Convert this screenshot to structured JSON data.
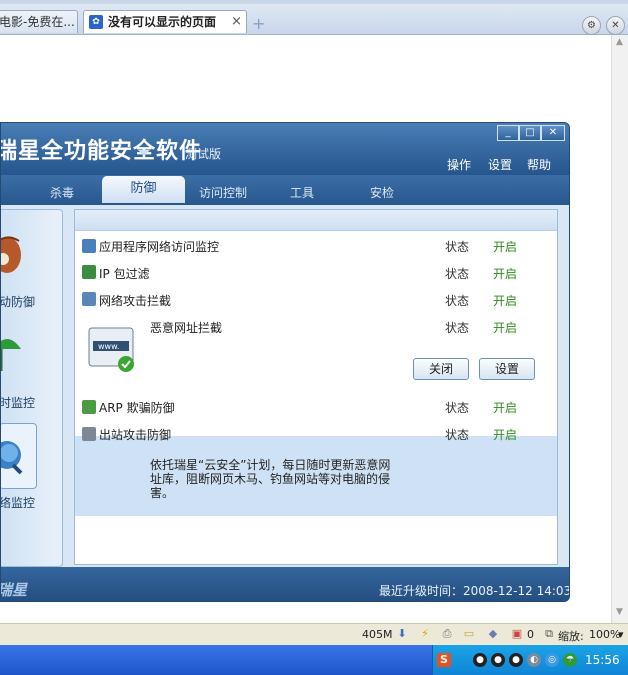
{
  "browser": {
    "tabs": [
      {
        "label": "电影-免费在..."
      },
      {
        "label": "没有可以显示的页面"
      }
    ],
    "tab_close_glyph": "×",
    "new_tab_glyph": "+",
    "tools_icon": "wrench-icon",
    "close_all_icon": "close-icon"
  },
  "app": {
    "title": "瑞星全功能安全软件",
    "edition": "测试版",
    "header_menu": [
      "操作",
      "设置",
      "帮助"
    ],
    "window_controls": [
      "minimize",
      "maximize",
      "close"
    ],
    "nav_tabs": [
      "杀毒",
      "防御",
      "访问控制",
      "工具",
      "安检"
    ],
    "active_tab": "防御",
    "left_panel": [
      {
        "label": "主动防御",
        "icon": "shield-glove-icon"
      },
      {
        "label": "实时监控",
        "icon": "umbrella-icon"
      },
      {
        "label": "网络监控",
        "icon": "globe-icon"
      }
    ],
    "rows": [
      {
        "label": "应用程序网络访问监控",
        "state": "状态",
        "value": "开启",
        "icon": "app-network-icon"
      },
      {
        "label": "IP 包过滤",
        "state": "状态",
        "value": "开启",
        "icon": "ip-filter-icon"
      },
      {
        "label": "网络攻击拦截",
        "state": "状态",
        "value": "开启",
        "icon": "attack-block-icon"
      }
    ],
    "expanded_row": {
      "label": "恶意网址拦截",
      "state": "状态",
      "value": "开启",
      "description": "依托瑞星“云安全”计划，每日随时更新恶意网址库，阻断网页木马、钓鱼网站等对电脑的侵害。",
      "icon_text": "www.",
      "close_button": "关闭",
      "settings_button": "设置"
    },
    "rows_after": [
      {
        "label": "ARP 欺骗防御",
        "state": "状态",
        "value": "开启",
        "icon": "arp-icon"
      },
      {
        "label": "出站攻击防御",
        "state": "状态",
        "value": "开启",
        "icon": "outbound-icon"
      }
    ],
    "footer_logo": "瑞星",
    "last_update_label": "最近升级时间：",
    "last_update_value": "2008-12-12 14:03"
  },
  "statusbar": {
    "memory": "405M",
    "counter": "0",
    "zoom_label": "缩放:",
    "zoom_value": "100%"
  },
  "taskbar": {
    "clock": "15:56"
  },
  "colors": {
    "app_blue": "#2d5b8e",
    "status_on": "#2e8b1e",
    "taskbar": "#1d55c9"
  }
}
